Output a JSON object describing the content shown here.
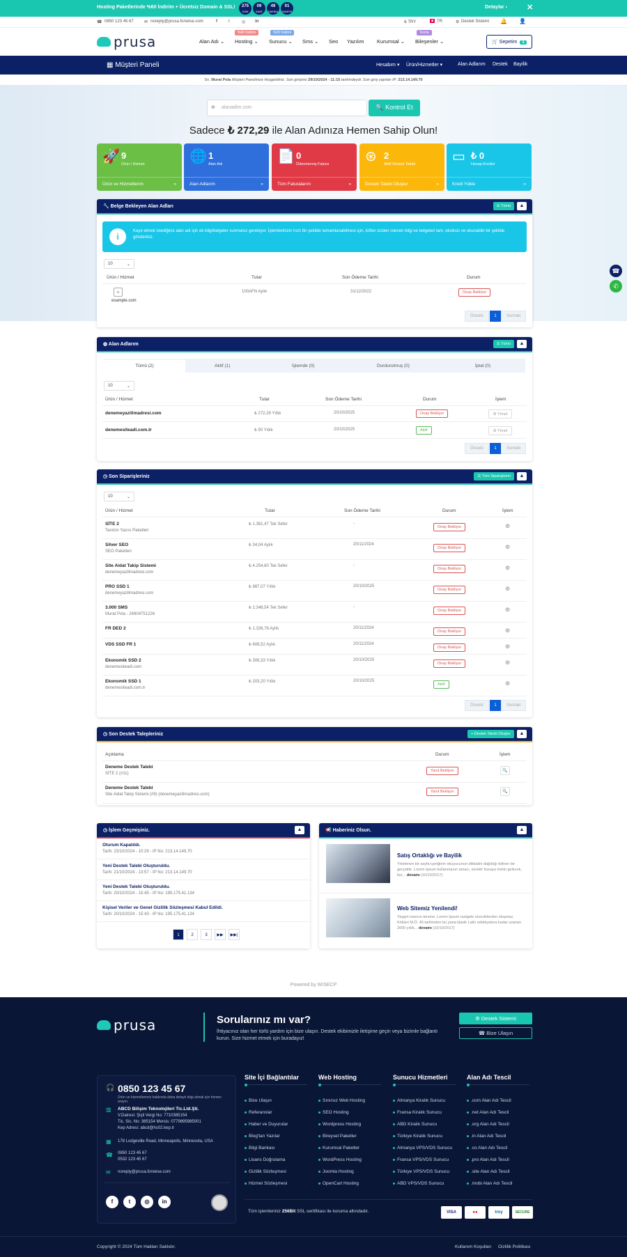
{
  "promo": {
    "text": "Hosting Paketlerinde %60 İndirim + Ücretsiz Domain & SSL!",
    "countdown": [
      {
        "v": "275",
        "u": "GÜN"
      },
      {
        "v": "09",
        "u": "SAAT"
      },
      {
        "v": "49",
        "u": "DAKİKA"
      },
      {
        "v": "01",
        "u": "SANİYE"
      }
    ],
    "details": "Detaylar ›",
    "close": "✕"
  },
  "topbar": {
    "phone": "0850 123 45 67",
    "email": "noreply@prusa.fonwise.com",
    "social": [
      "f",
      "t",
      "◎",
      "in"
    ],
    "currency": "₺ TRY",
    "lang": "TR",
    "support": "Destek Sistemi"
  },
  "brand": {
    "name": "prusa"
  },
  "nav": {
    "items": [
      "Alan Adı ⌄",
      "Hosting ⌄",
      "Sunucu ⌄",
      "Sms ⌄",
      "Seo",
      "Yazılım",
      "Kurumsal ⌄",
      "Bileşenler ⌄"
    ],
    "tags": [
      "%60 İndirim",
      "%20 İndirim",
      "Teoria"
    ],
    "cart": "Sepetim",
    "cart_count": "1"
  },
  "panel": {
    "title": "Müşteri Paneli",
    "menu": [
      "Hesabım ▾",
      "Ürün/Hizmetler ▾",
      "Alan Adlarım",
      "Destek",
      "Bayilik"
    ]
  },
  "info": {
    "prefix": "Sn.",
    "name": "Murat Pola",
    "text1": "Müşteri Panelinize Hoşgeldiniz. Son girişiniz",
    "date": "29/10/2024 - 11:15",
    "text2": "tarihindeydi. Son giriş yapılan IP:",
    "ip": "213.14.149.70"
  },
  "hero": {
    "placeholder": "alanadim.com",
    "button": "Kontrol Et",
    "headline_pre": "Sadece",
    "price": "₺ 272,29",
    "headline_post": "ile Alan Adınıza Hemen Sahip Olun!"
  },
  "stats": [
    {
      "num": "9",
      "label": "Ürün / Hizmet",
      "link": "Ürün ve Hizmetlerim",
      "icon": "🚀",
      "color": "#6cbf45"
    },
    {
      "num": "1",
      "label": "Alan Adı",
      "link": "Alan Adlarım",
      "icon": "🌐",
      "color": "#2f6fdb"
    },
    {
      "num": "0",
      "label": "Ödenmemiş Fatura",
      "link": "Tüm Faturalarım",
      "icon": "📄",
      "color": "#e03a46"
    },
    {
      "num": "2",
      "label": "Aktif Destek Talebi",
      "link": "Destek Talebi Oluştur",
      "icon": "⊛",
      "color": "#fbb80b"
    },
    {
      "num": "₺ 0",
      "label": "Hesap Kredisi",
      "link": "Kredi Yükle",
      "icon": "▭",
      "color": "#19c6e8"
    }
  ],
  "pending": {
    "title": "Belge Bekleyen Alan Adları",
    "all": "Tümü",
    "alert": "Kayıt etmek istediğiniz alan adı için ek bilgi/belgeler sunmanız gerekiyor. İşlemlerinizin hızlı bir şekilde tamamlanabilmesi için, lütfen sizden istenen bilgi ve belgeleri tam, eksiksiz ve okunabilir bir şekilde gönderiniz.",
    "len": "10",
    "cols": [
      "Ürün / Hizmet",
      "Tutar",
      "Son Ödeme Tarihi",
      "Durum"
    ],
    "row": {
      "domain": "example.com",
      "amount": "100AFN Aylık",
      "due": "31/12/2022",
      "status": "Onay Bekliyor"
    },
    "prev": "Önceki",
    "page": "1",
    "next": "Sonraki"
  },
  "domains": {
    "title": "Alan Adlarım",
    "all": "Tümü",
    "tabs": [
      "Tümü (2)",
      "Aktif (1)",
      "İşlemde (0)",
      "Durdurulmuş (0)",
      "İptal (0)"
    ],
    "len": "10",
    "cols": [
      "Ürün / Hizmet",
      "Tutar",
      "Son Ödeme Tarihi",
      "Durum",
      "İşlem"
    ],
    "rows": [
      {
        "d": "denemeyazilimadresi.com",
        "a": "₺ 272,29 Yıllık",
        "t": "20/10/2025",
        "s": "Onay Bekliyor",
        "c": "#d9534f"
      },
      {
        "d": "denemesiteadi.com.tr",
        "a": "₺ 50 Yıllık",
        "t": "20/10/2025",
        "s": "Aktif",
        "c": "#5cb85c"
      }
    ],
    "manage": "⚙ Yönet",
    "prev": "Önceki",
    "page": "1",
    "next": "Sonraki"
  },
  "orders": {
    "title": "Son Siparişleriniz",
    "all": "Tüm Siparişlerim",
    "len": "10",
    "cols": [
      "Ürün / Hizmet",
      "Tutar",
      "Son Ödeme Tarihi",
      "Durum",
      "İşlem"
    ],
    "rows": [
      {
        "n": "SİTE 2",
        "s": "Tanıtım Yazısı Paketleri",
        "a": "₺ 1.361,47 Tek Sefer",
        "t": "-",
        "st": "Onay Bekliyor",
        "c": "#d9534f"
      },
      {
        "n": "Silver SEO",
        "s": "SEO Paketleri",
        "a": "₺ 34,04 Aylık",
        "t": "20/11/2024",
        "st": "Onay Bekliyor",
        "c": "#d9534f"
      },
      {
        "n": "Site Aidat Takip Sistemi",
        "s": "denemeyazilimadresi.com",
        "a": "₺ 4.254,60 Tek Sefer",
        "t": "-",
        "st": "Onay Bekliyor",
        "c": "#d9534f"
      },
      {
        "n": "PRO SSD 1",
        "s": "denemeyazilimadresi.com",
        "a": "₺ 987,07 Yıllık",
        "t": "20/10/2025",
        "st": "Onay Bekliyor",
        "c": "#d9534f"
      },
      {
        "n": "3.000 SMS",
        "s": "Murat Pola - 24904751226",
        "a": "₺ 2.348,54 Tek Sefer",
        "t": "-",
        "st": "Onay Bekliyor",
        "c": "#d9534f"
      },
      {
        "n": "FR DED 2",
        "s": "",
        "a": "₺ 1.326,76 Aylık",
        "t": "20/11/2024",
        "st": "Onay Bekliyor",
        "c": "#d9534f"
      },
      {
        "n": "VDS SSD FR 1",
        "s": "",
        "a": "₺ 606,52 Aylık",
        "t": "20/11/2024",
        "st": "Onay Bekliyor",
        "c": "#d9534f"
      },
      {
        "n": "Ekonomik SSD 2",
        "s": "denemesiteadi.com",
        "a": "₺ 306,33 Yıllık",
        "t": "20/10/2025",
        "st": "Onay Bekliyor",
        "c": "#d9534f"
      },
      {
        "n": "Ekonomik SSD 1",
        "s": "denemesiteadi.com.tr",
        "a": "₺ 203,20 Yıllık",
        "t": "20/10/2025",
        "st": "Aktif",
        "c": "#5cb85c"
      }
    ],
    "prev": "Önceki",
    "page": "1",
    "next": "Sonraki"
  },
  "tickets": {
    "title": "Son Destek Talepleriniz",
    "new": "+ Destek Talebi Oluştur",
    "cols": [
      "Açıklama",
      "Durum",
      "İşlem"
    ],
    "rows": [
      {
        "n": "Deneme Destek Talebi",
        "s": "SİTE 2 (#11)",
        "st": "Yanıt Bekliyor"
      },
      {
        "n": "Deneme Destek Talebi",
        "s": "Site Aidat Takip Sistemi (#9) (denemeyazilimadresi.com)",
        "st": "Yanıt Bekliyor"
      }
    ]
  },
  "history": {
    "title": "İşlem Geçmişiniz.",
    "rows": [
      {
        "n": "Oturum Kapatıldı.",
        "d": "Tarih: 23/10/2024 - 10:29 - IP No: 213.14.149.70"
      },
      {
        "n": "Yeni Destek Talebi Oluşturuldu.",
        "d": "Tarih: 21/10/2024 - 13:57 - IP No: 213.14.149.70"
      },
      {
        "n": "Yeni Destek Talebi Oluşturuldu.",
        "d": "Tarih: 20/10/2024 - 15:45 - IP No: 195.175.41.134"
      },
      {
        "n": "Kişisel Veriler ve Genel Gizlilik Sözleşmesi Kabul Edildi.",
        "d": "Tarih: 20/10/2024 - 15:43 - IP No: 195.175.41.134"
      }
    ],
    "pages": [
      "1",
      "2",
      "3",
      "▶▶",
      "▶▶|"
    ]
  },
  "news": {
    "title": "Haberiniz Olsun.",
    "items": [
      {
        "t": "Satış Ortaklığı ve Bayilik",
        "d": "Yinelenen bir sayfa içeriğinin okuyucunun dikkatini dağıttığı bilinen bir gerçektir. Lorem Ipsum kullanmanın amacı, sürekli 'buraya metin gelecek, bur...",
        "more": "devamı",
        "date": "(10/10/2017)"
      },
      {
        "t": "Web Sitemiz Yenilendi!",
        "d": "Yaygın inancın tersine, Lorem Ipsum rastgele sözcüklerden oluşmaz. Kökleri M.Ö. 45 tarihinden bu yana klasik Latin edebiyatına kadar uzanan 2000 yıllık...",
        "more": "devamı",
        "date": "(10/10/2017)"
      }
    ]
  },
  "powered": "Powered by WISECP",
  "footer": {
    "q": "Sorularınız mı var?",
    "qtext": "İhtiyacınız olan her türlü yardım için bize ulaşın. Destek ekibimizle iletişime geçin veya bizimle bağlantı kurun. Size hizmet etmek için buradayız!",
    "btn1": "⚙ Destek Sistemi",
    "btn2": "☎ Bize Ulaşın",
    "phone": "0850 123 45 67",
    "phone_note": "Ürün ve hizmetlerimiz hakkında daha detaylı bilgi almak için hemen arayın.",
    "company": "ABCD Bilişim Teknolojileri Tic.Ltd.Şti.",
    "company_lines": [
      "V.Dairesi: Şişli Vergi No: 7710385154",
      "Tic. Sic. No: 385154 Mersis: 0779895985001",
      "Kep Adresi: abcd@hs02.kep.tr"
    ],
    "address": "178 Lodgeville Road, Minneapolis, Minnesota, USA",
    "phones": [
      "0850 123 45 67",
      "0532 123 45 67"
    ],
    "email": "noreply@prusa.fonwise.com",
    "social": [
      "f",
      "t",
      "◎",
      "in"
    ],
    "cols": [
      {
        "h": "Site İçi Bağlantılar",
        "l": [
          "Bize Ulaşın",
          "Referanslar",
          "Haber ve Duyurular",
          "Blog'tan Yazılar",
          "Bilgi Bankası",
          "Lisans Doğrulama",
          "Gizlilik Sözleşmesi",
          "Hizmet Sözleşmesi"
        ]
      },
      {
        "h": "Web Hosting",
        "l": [
          "Sınırsız Web Hosting",
          "SEO Hosting",
          "Wordpress Hosting",
          "Bireysel Paketler",
          "Kurumsal Paketler",
          "WordPress Hosting",
          "Joomla Hosting",
          "OpenCart Hosting"
        ]
      },
      {
        "h": "Sunucu Hizmetleri",
        "l": [
          "Almanya Kiralık Sunucu",
          "Fransa Kiralık Sunucu",
          "ABD Kiralık Sunucu",
          "Türkiye Kiralık Sunucu",
          "Almanya VPS/VDS Sunucu",
          "Fransa VPS/VDS Sunucu",
          "Türkiye VPS/VDS Sunucu",
          "ABD VPS/VDS Sunucu"
        ]
      },
      {
        "h": "Alan Adı Tescil",
        "l": [
          ".com Alan Adı Tescil",
          ".net Alan Adı Tescil",
          ".org Alan Adı Tescil",
          ".in Alan Adı Tescil",
          ".co Alan Adı Tescil",
          ".pro Alan Adı Tescil",
          ".site Alan Adı Tescil",
          ".mobi Alan Adı Tescil"
        ]
      }
    ],
    "ssl_pre": "Tüm işlemleriniz",
    "ssl_b": "256Bit",
    "ssl_post": "SSL sertifikası ile koruma altındadır.",
    "pay": [
      "VISA",
      "●●",
      "troy",
      "SECURE"
    ],
    "copy": "Copyright © 2024 Tüm Hakları Saklıdır.",
    "links": [
      "Kullanım Koşulları",
      "Gizlilik Politikası"
    ]
  }
}
